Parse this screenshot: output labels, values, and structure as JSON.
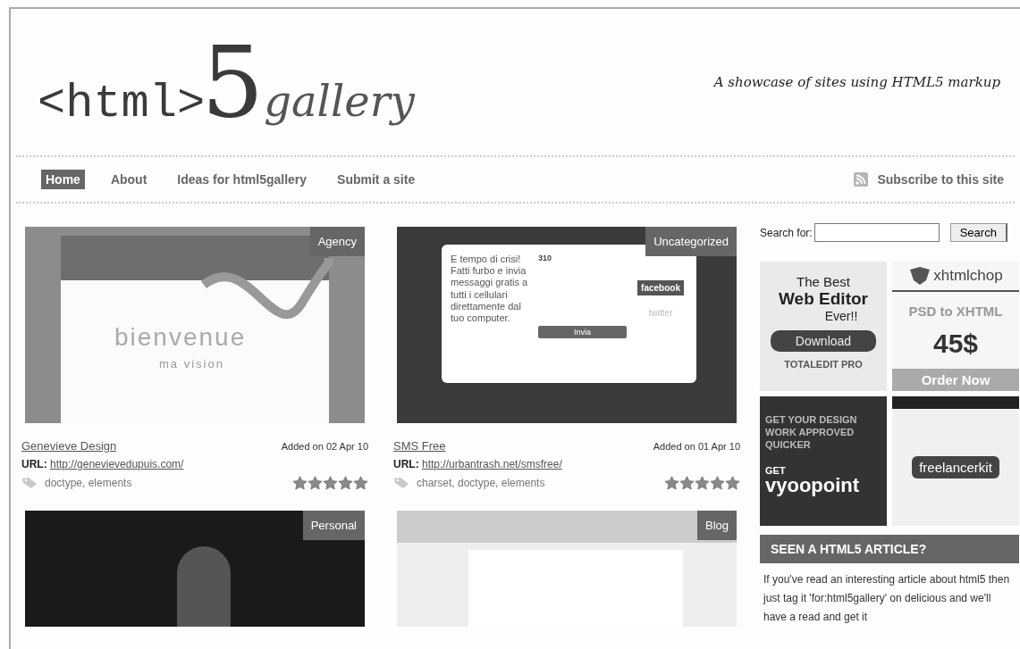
{
  "header": {
    "logo": {
      "tag": "<html>",
      "number": "5",
      "word": "gallery"
    },
    "tagline": "A showcase of sites using HTML5 markup"
  },
  "nav": {
    "items": [
      {
        "label": "Home",
        "selected": true
      },
      {
        "label": "About",
        "selected": false
      },
      {
        "label": "Ideas for html5gallery",
        "selected": false
      },
      {
        "label": "Submit a site",
        "selected": false
      }
    ],
    "subscribe": "Subscribe to this site"
  },
  "sites": [
    {
      "kind": "light",
      "category": "Agency",
      "title": "Genevieve Design",
      "added": "Added on 02 Apr 10",
      "url_label": "URL:",
      "url": "http://genevievedupuis.com/",
      "tags": "doctype, elements",
      "stars": 5,
      "shot_texts": [
        "bienvenue",
        "ma vision"
      ]
    },
    {
      "kind": "dialog",
      "category": "Uncategorized",
      "title": "SMS Free",
      "added": "Added on 01 Apr 10",
      "url_label": "URL:",
      "url": "http://urbantrash.net/smsfree/",
      "tags": "charset, doctype, elements",
      "stars": 5,
      "shot_texts": [
        "E tempo di crisi! Fatti furbo e invia messaggi gratis a tutti i cellulari direttamente dal tuo computer.",
        "310",
        "Invia",
        "facebook",
        "twitter"
      ]
    },
    {
      "kind": "dark",
      "category": "Personal"
    },
    {
      "kind": "banner",
      "category": "Blog"
    }
  ],
  "sidebar": {
    "search_label": "Search for:",
    "search_button": "Search",
    "ads": [
      {
        "kind": "editor",
        "lines": [
          "The Best",
          "Web Editor",
          "Ever!!",
          "Download",
          "TOTALEDIT PRO"
        ]
      },
      {
        "kind": "chop",
        "lines": [
          "xhtmlchop",
          "PSD to XHTML",
          "45$",
          "Order Now"
        ]
      },
      {
        "kind": "vyoo",
        "lines": [
          "GET YOUR DESIGN WORK APPROVED QUICKER",
          "GET",
          "vyoopoint"
        ]
      },
      {
        "kind": "kit",
        "lines": [
          "freelancerkit"
        ]
      }
    ],
    "article_heading": "SEEN A HTML5 ARTICLE?",
    "article_text": "If you've read an interesting article about html5 then just tag it 'for:html5gallery' on delicious and we'll have a read and get it"
  }
}
